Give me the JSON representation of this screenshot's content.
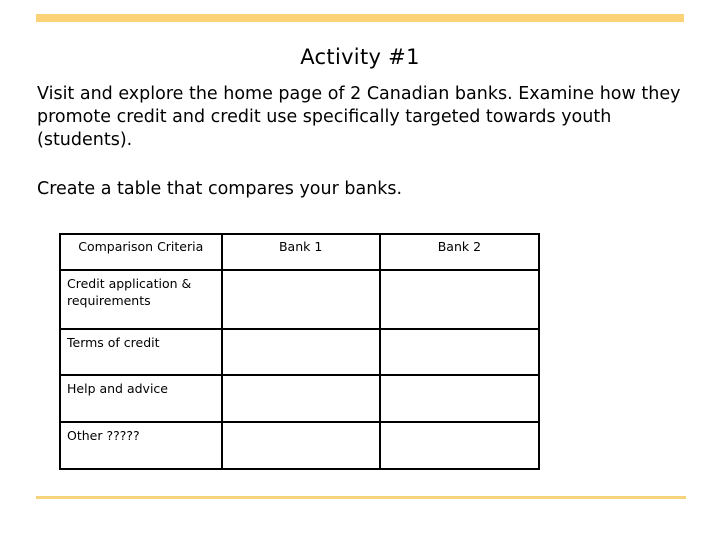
{
  "slide": {
    "title": "Activity #1",
    "instructions": "Visit and explore the home page of 2 Canadian banks. Examine how they promote credit and credit use specifically targeted towards youth (students).",
    "task": "Create a table that compares your banks.",
    "accent_color": "#fbd276"
  },
  "table": {
    "headers": [
      "Comparison Criteria",
      "Bank 1",
      "Bank 2"
    ],
    "rows": [
      {
        "criteria": "Credit application & requirements",
        "bank1": "",
        "bank2": ""
      },
      {
        "criteria": "Terms of credit",
        "bank1": "",
        "bank2": ""
      },
      {
        "criteria": "Help and advice",
        "bank1": "",
        "bank2": ""
      },
      {
        "criteria": "Other ?????",
        "bank1": "",
        "bank2": ""
      }
    ]
  }
}
